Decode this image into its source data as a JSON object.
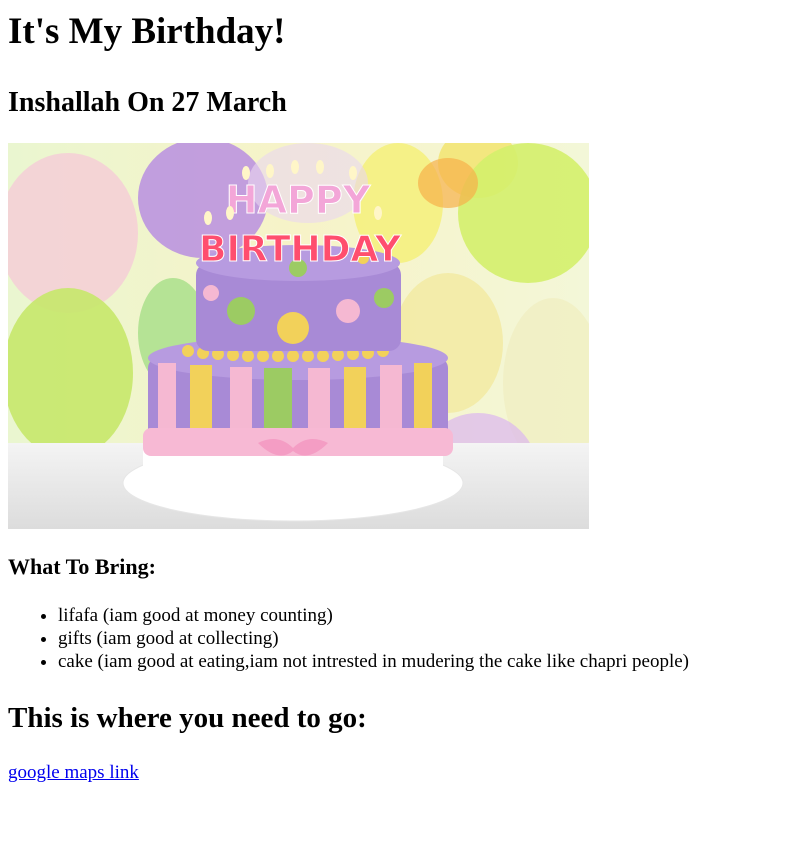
{
  "page": {
    "title": "It's My Birthday!",
    "subtitle": "Inshallah On 27 March"
  },
  "image": {
    "description_icon": "birthday-cake-image",
    "cake_text_top": "HAPPY",
    "cake_text_bottom": "BIRTHDAY"
  },
  "bring": {
    "heading": "What To Bring:",
    "items": [
      "lifafa (iam good at money counting)",
      "gifts (iam good at collecting)",
      "cake (iam good at eating,iam not intrested in mudering the cake like chapri people)"
    ]
  },
  "location": {
    "heading": "This is where you need to go:",
    "link_text": "google maps link"
  },
  "colors": {
    "link": "#0000ee",
    "cake_purple": "#a88ad6",
    "cake_yellow": "#f2d15a",
    "cake_pink": "#f5b8d2",
    "cake_green": "#9ccb63"
  }
}
